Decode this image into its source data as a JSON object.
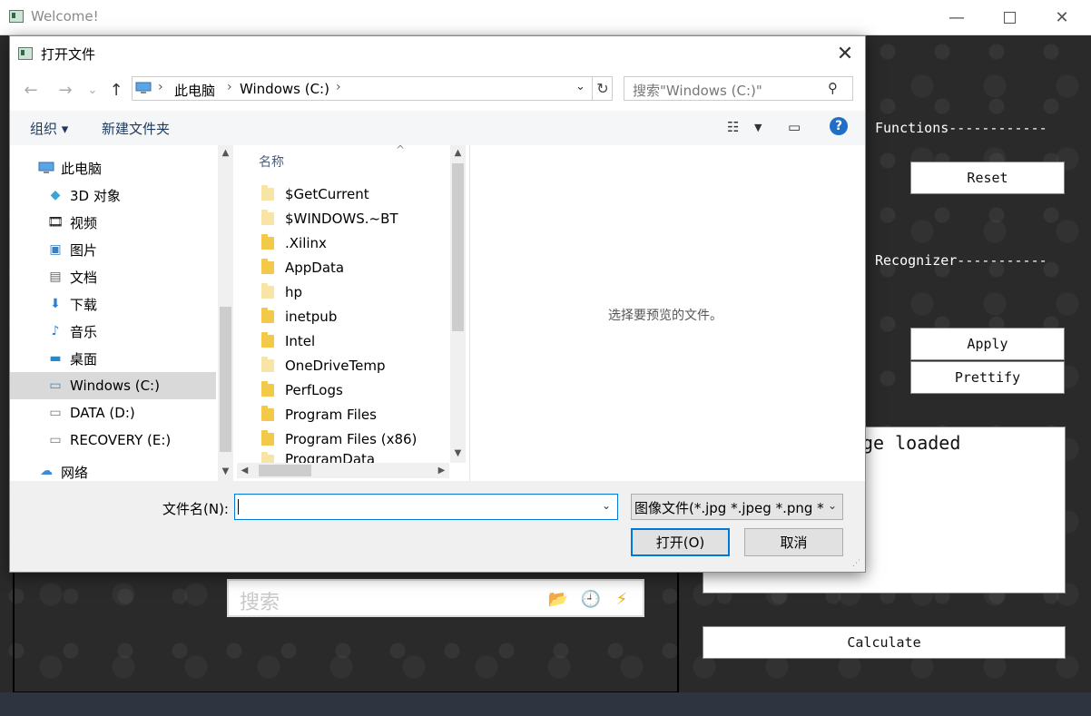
{
  "main_window": {
    "title": "Welcome!",
    "controls": {
      "minimize": "—",
      "maximize": "",
      "close": "✕"
    },
    "functions_label": "Functions------------",
    "reset_label": "Reset",
    "recognizer_label": "Recognizer-----------",
    "apply_label": "Apply",
    "prettify_label": "Prettify",
    "output_text": "ge loaded",
    "search_placeholder": "搜索",
    "calculate_label": "Calculate"
  },
  "dialog": {
    "title": "打开文件",
    "close": "✕",
    "nav": {
      "back": "←",
      "forward": "→",
      "recent": "⌄",
      "up": "↑"
    },
    "breadcrumb": [
      "此电脑",
      "Windows (C:)"
    ],
    "search_placeholder": "搜索\"Windows (C:)\"",
    "toolbar": {
      "organize": "组织 ▾",
      "new_folder": "新建文件夹"
    },
    "sidebar": [
      {
        "label": "此电脑",
        "icon": "computer-icon",
        "indent": 1
      },
      {
        "label": "3D 对象",
        "icon": "cube-icon",
        "indent": 2
      },
      {
        "label": "视频",
        "icon": "video-icon",
        "indent": 2
      },
      {
        "label": "图片",
        "icon": "picture-icon",
        "indent": 2
      },
      {
        "label": "文档",
        "icon": "document-icon",
        "indent": 2
      },
      {
        "label": "下载",
        "icon": "download-icon",
        "indent": 2
      },
      {
        "label": "音乐",
        "icon": "music-icon",
        "indent": 2
      },
      {
        "label": "桌面",
        "icon": "desktop-icon",
        "indent": 2
      },
      {
        "label": "Windows (C:)",
        "icon": "drive-icon",
        "indent": 2,
        "selected": true
      },
      {
        "label": "DATA (D:)",
        "icon": "drive-icon",
        "indent": 2
      },
      {
        "label": "RECOVERY (E:)",
        "icon": "drive-icon",
        "indent": 2
      },
      {
        "label": "网络",
        "icon": "network-icon",
        "indent": 1
      }
    ],
    "column_header": "名称",
    "files": [
      {
        "name": "$GetCurrent",
        "hidden": true
      },
      {
        "name": "$WINDOWS.~BT",
        "hidden": true
      },
      {
        "name": ".Xilinx",
        "hidden": false
      },
      {
        "name": "AppData",
        "hidden": false
      },
      {
        "name": "hp",
        "hidden": true
      },
      {
        "name": "inetpub",
        "hidden": false
      },
      {
        "name": "Intel",
        "hidden": false
      },
      {
        "name": "OneDriveTemp",
        "hidden": true
      },
      {
        "name": "PerfLogs",
        "hidden": false
      },
      {
        "name": "Program Files",
        "hidden": false
      },
      {
        "name": "Program Files (x86)",
        "hidden": false
      },
      {
        "name": "ProgramData",
        "hidden": true
      }
    ],
    "preview_message": "选择要预览的文件。",
    "filename_label": "文件名(N):",
    "filename_value": "",
    "filter_value": "图像文件(*.jpg *.jpeg *.png *.",
    "open_label": "打开(O)",
    "cancel_label": "取消"
  },
  "colors": {
    "accent": "#0078d7",
    "selection": "#d9d9d9",
    "help": "#1f6fc9",
    "folder": "#f3c94a"
  }
}
